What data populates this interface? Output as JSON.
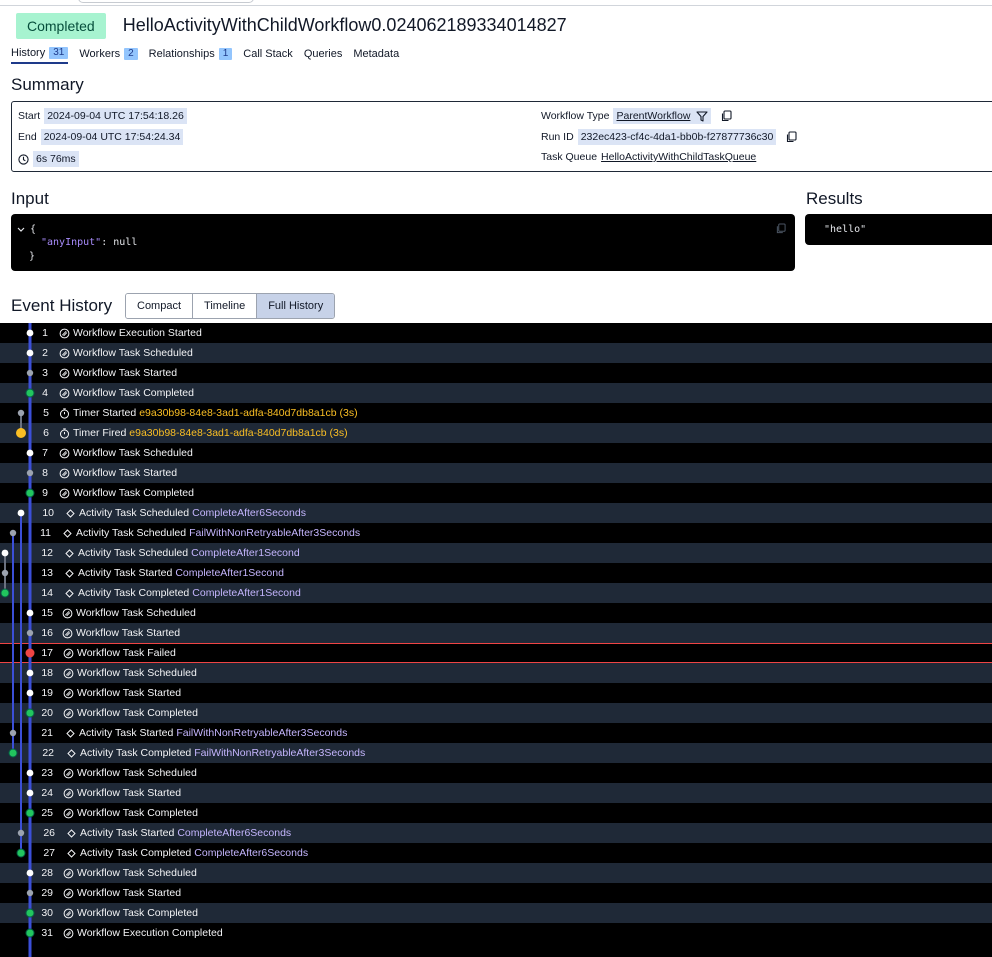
{
  "status": "Completed",
  "workflow_id": "HelloActivityWithChildWorkflow0.024062189334014827",
  "tabs": [
    {
      "label": "History",
      "count": "31"
    },
    {
      "label": "Workers",
      "count": "2"
    },
    {
      "label": "Relationships",
      "count": "1"
    },
    {
      "label": "Call Stack"
    },
    {
      "label": "Queries"
    },
    {
      "label": "Metadata"
    }
  ],
  "summary": {
    "title": "Summary",
    "start_label": "Start",
    "start_value": "2024-09-04 UTC 17:54:18.26",
    "end_label": "End",
    "end_value": "2024-09-04 UTC 17:54:24.34",
    "duration": "6s 76ms",
    "workflow_type_label": "Workflow Type",
    "workflow_type_value": "ParentWorkflow",
    "run_id_label": "Run ID",
    "run_id_value": "232ec423-cf4c-4da1-bb0b-f27877736c30",
    "task_queue_label": "Task Queue",
    "task_queue_value": "HelloActivityWithChildTaskQueue"
  },
  "input": {
    "title": "Input",
    "open_brace": "{",
    "key": "\"anyInput\"",
    "colon": ": ",
    "value": "null",
    "close_brace": "}"
  },
  "results": {
    "title": "Results",
    "value": "\"hello\""
  },
  "event_history": {
    "title": "Event History",
    "views": [
      "Compact",
      "Timeline",
      "Full History"
    ],
    "active_view": "Full History",
    "events": [
      {
        "n": "1",
        "name": "Workflow Execution Started",
        "kind": "wf"
      },
      {
        "n": "2",
        "name": "Workflow Task Scheduled",
        "kind": "wf"
      },
      {
        "n": "3",
        "name": "Workflow Task Started",
        "kind": "wf"
      },
      {
        "n": "4",
        "name": "Workflow Task Completed",
        "kind": "wf"
      },
      {
        "n": "5",
        "name": "Timer Started",
        "kind": "timer",
        "meta": "e9a30b98-84e8-3ad1-adfa-840d7db8a1cb (3s)"
      },
      {
        "n": "6",
        "name": "Timer Fired",
        "kind": "timer",
        "meta": "e9a30b98-84e8-3ad1-adfa-840d7db8a1cb (3s)"
      },
      {
        "n": "7",
        "name": "Workflow Task Scheduled",
        "kind": "wf"
      },
      {
        "n": "8",
        "name": "Workflow Task Started",
        "kind": "wf"
      },
      {
        "n": "9",
        "name": "Workflow Task Completed",
        "kind": "wf"
      },
      {
        "n": "10",
        "name": "Activity Task Scheduled",
        "kind": "act",
        "meta": "CompleteAfter6Seconds"
      },
      {
        "n": "11",
        "name": "Activity Task Scheduled",
        "kind": "act",
        "meta": "FailWithNonRetryableAfter3Seconds"
      },
      {
        "n": "12",
        "name": "Activity Task Scheduled",
        "kind": "act",
        "meta": "CompleteAfter1Second"
      },
      {
        "n": "13",
        "name": "Activity Task Started",
        "kind": "act",
        "meta": "CompleteAfter1Second"
      },
      {
        "n": "14",
        "name": "Activity Task Completed",
        "kind": "act",
        "meta": "CompleteAfter1Second"
      },
      {
        "n": "15",
        "name": "Workflow Task Scheduled",
        "kind": "wf"
      },
      {
        "n": "16",
        "name": "Workflow Task Started",
        "kind": "wf"
      },
      {
        "n": "17",
        "name": "Workflow Task Failed",
        "kind": "wf"
      },
      {
        "n": "18",
        "name": "Workflow Task Scheduled",
        "kind": "wf"
      },
      {
        "n": "19",
        "name": "Workflow Task Started",
        "kind": "wf"
      },
      {
        "n": "20",
        "name": "Workflow Task Completed",
        "kind": "wf"
      },
      {
        "n": "21",
        "name": "Activity Task Started",
        "kind": "act",
        "meta": "FailWithNonRetryableAfter3Seconds"
      },
      {
        "n": "22",
        "name": "Activity Task Completed",
        "kind": "act",
        "meta": "FailWithNonRetryableAfter3Seconds"
      },
      {
        "n": "23",
        "name": "Workflow Task Scheduled",
        "kind": "wf"
      },
      {
        "n": "24",
        "name": "Workflow Task Started",
        "kind": "wf"
      },
      {
        "n": "25",
        "name": "Workflow Task Completed",
        "kind": "wf"
      },
      {
        "n": "26",
        "name": "Activity Task Started",
        "kind": "act",
        "meta": "CompleteAfter6Seconds"
      },
      {
        "n": "27",
        "name": "Activity Task Completed",
        "kind": "act",
        "meta": "CompleteAfter6Seconds"
      },
      {
        "n": "28",
        "name": "Workflow Task Scheduled",
        "kind": "wf"
      },
      {
        "n": "29",
        "name": "Workflow Task Started",
        "kind": "wf"
      },
      {
        "n": "30",
        "name": "Workflow Task Completed",
        "kind": "wf"
      },
      {
        "n": "31",
        "name": "Workflow Execution Completed",
        "kind": "wf"
      }
    ]
  },
  "colors": {
    "completed_badge": "#a7f3d0",
    "timeline_blue": "#3b4fd8",
    "dot_green": "#22c55e",
    "dot_orange": "#fbbf24",
    "dot_red": "#ef4444",
    "meta_purple": "#c4b5fd",
    "meta_amber": "#fbbf24"
  },
  "icons": {
    "copy": "copy-icon",
    "filter": "filter-icon",
    "clock": "clock-icon",
    "chevron": "chevron-down-icon",
    "workflow_event": "workflow-event-icon",
    "timer_event": "timer-icon",
    "activity_event": "activity-diamond-icon"
  }
}
